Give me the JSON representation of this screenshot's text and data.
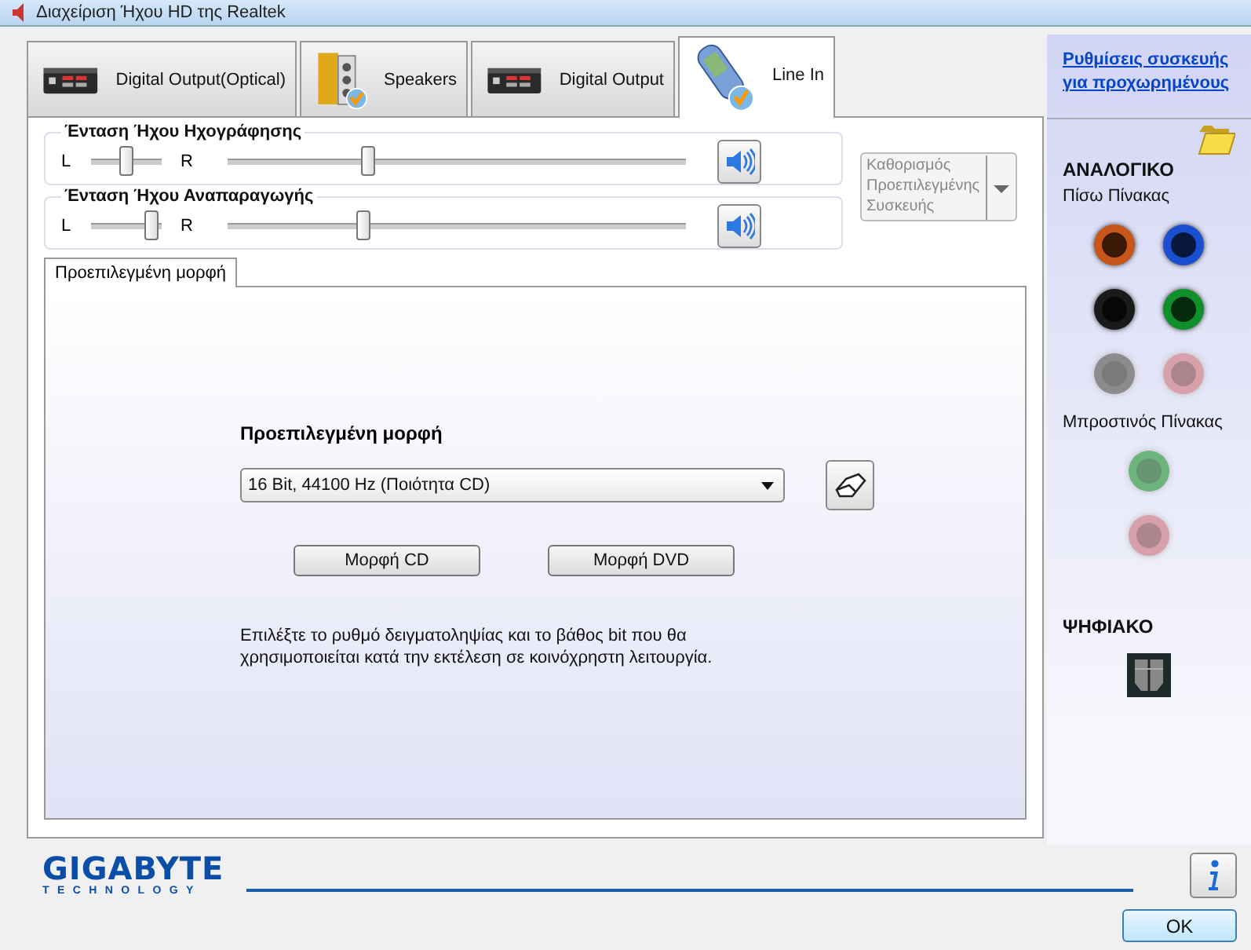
{
  "window": {
    "title": "Διαχείριση Ήχου HD της Realtek"
  },
  "tabs": [
    {
      "label": "Digital Output(Optical)",
      "kind": "receiver",
      "selected": false
    },
    {
      "label": "Speakers",
      "kind": "speakers",
      "selected": false
    },
    {
      "label": "Digital Output",
      "kind": "receiver",
      "selected": false
    },
    {
      "label": "Line In",
      "kind": "player",
      "selected": true
    }
  ],
  "volumes": [
    {
      "label": "Ένταση Ήχου Ηχογράφησης",
      "left": "L",
      "right": "R",
      "balance": {
        "level": 0.5
      },
      "volume": {
        "level": 0.3
      }
    },
    {
      "label": "Ένταση Ήχου Αναπαραγωγής",
      "left": "L",
      "right": "R",
      "balance": {
        "level": 0.95
      },
      "volume": {
        "level": 0.29
      }
    }
  ],
  "default_device": {
    "label": "Καθορισμός Προεπιλεγμένης Συσκευής",
    "disabled": true
  },
  "inner_tabs": [
    {
      "label": "Προεπιλεγμένη μορφή",
      "selected": true
    }
  ],
  "default_format": {
    "heading": "Προεπιλεγμένη μορφή",
    "value": "16 Bit, 44100 Hz (Ποιότητα CD)",
    "buttons": [
      "Μορφή CD",
      "Μορφή DVD"
    ],
    "description": "Επιλέξτε το ρυθμό δειγματοληψίας και το βάθος bit που θα χρησιμοποιείται κατά την εκτέλεση σε κοινόχρηστη λειτουργία."
  },
  "side_panel": {
    "advanced_link": "Ρυθμίσεις συσκευής για προχωρημένους",
    "analog_heading": "ΑΝΑΛΟΓΙΚΟ",
    "back_panel": {
      "label": "Πίσω Πίνακας",
      "jacks": [
        {
          "color": "#c8561a",
          "active": true
        },
        {
          "color": "#1a4fd0",
          "active": true
        },
        {
          "color": "#1a1a1a",
          "active": true
        },
        {
          "color": "#10902a",
          "active": true
        },
        {
          "color": "#8c8c8c",
          "active": false
        },
        {
          "color": "#d8a0aa",
          "active": false
        }
      ]
    },
    "front_panel": {
      "label": "Μπροστινός Πίνακας",
      "jacks": [
        {
          "color": "#6cb47c",
          "active": false
        },
        {
          "color": "#d8a0aa",
          "active": false
        }
      ]
    },
    "digital_heading": "ΨΗΦΙΑΚΟ"
  },
  "footer": {
    "logo": "GIGABYTE",
    "logo_tagline": "TECHNOLOGY",
    "ok_button": "OK"
  }
}
